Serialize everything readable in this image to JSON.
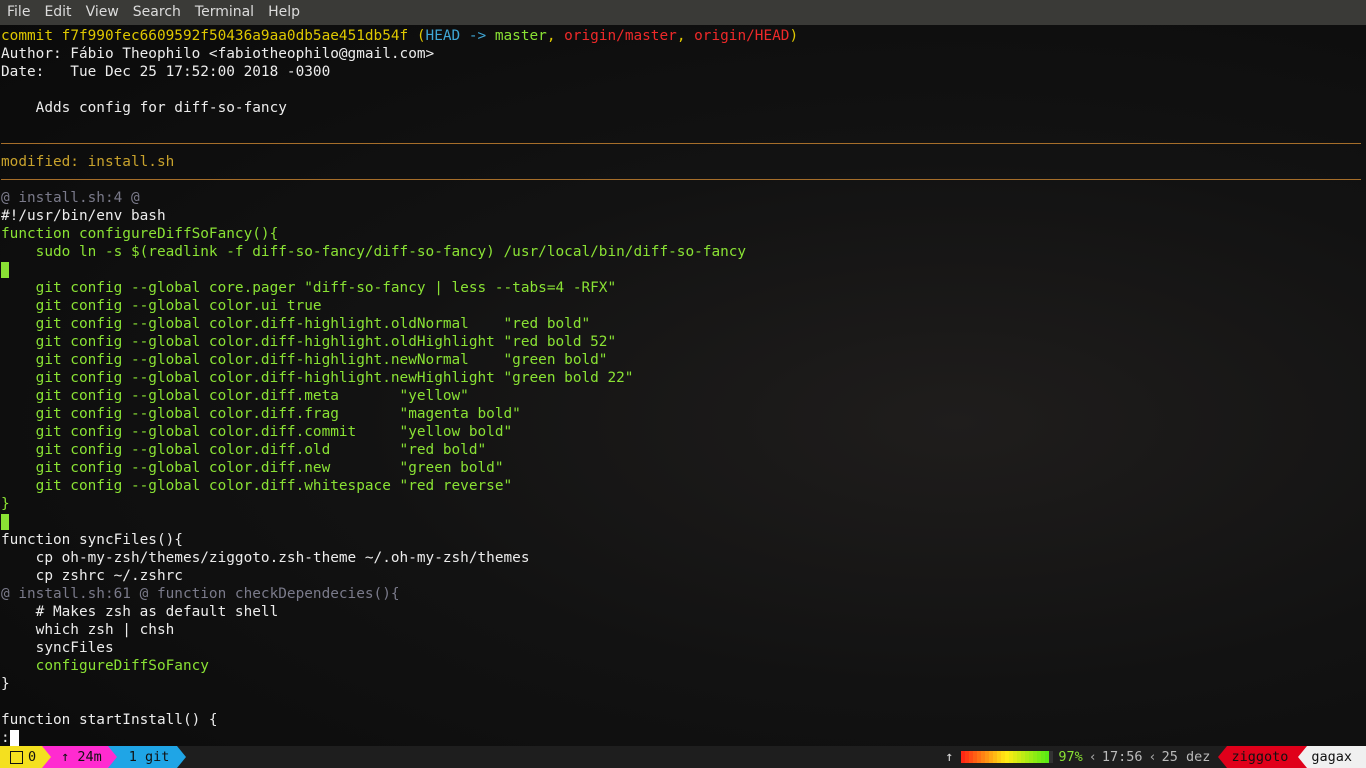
{
  "menu": [
    "File",
    "Edit",
    "View",
    "Search",
    "Terminal",
    "Help"
  ],
  "commit": {
    "prefix": "commit ",
    "hash": "f7f990fec6609592f50436a9aa0db5ae451db54f",
    "open": " (",
    "head": "HEAD",
    "arrow": " -> ",
    "branch": "master",
    "sep1": ", ",
    "origin_master": "origin/master",
    "sep2": ", ",
    "origin_head": "origin/HEAD",
    "close": ")",
    "author": "Author: Fábio Theophilo <fabiotheophilo@gmail.com>",
    "date": "Date:   Tue Dec 25 17:52:00 2018 -0300",
    "message": "    Adds config for diff-so-fancy"
  },
  "modified": "modified: install.sh",
  "hunk1": "@ install.sh:4 @",
  "hunk2_marker": "@ install.sh:61 @ ",
  "hunk2_context": "function checkDependecies(){",
  "code": {
    "shebang": "#!/usr/bin/env bash",
    "fn_head": "function configureDiffSoFancy(){",
    "sudo": "    sudo ln -s $(readlink -f diff-so-fancy/diff-so-fancy) /usr/local/bin/diff-so-fancy",
    "git_lines": [
      "    git config --global core.pager \"diff-so-fancy | less --tabs=4 -RFX\"",
      "    git config --global color.ui true",
      "    git config --global color.diff-highlight.oldNormal    \"red bold\"",
      "    git config --global color.diff-highlight.oldHighlight \"red bold 52\"",
      "    git config --global color.diff-highlight.newNormal    \"green bold\"",
      "    git config --global color.diff-highlight.newHighlight \"green bold 22\"",
      "    git config --global color.diff.meta       \"yellow\"",
      "    git config --global color.diff.frag       \"magenta bold\"",
      "    git config --global color.diff.commit     \"yellow bold\"",
      "    git config --global color.diff.old        \"red bold\"",
      "    git config --global color.diff.new        \"green bold\"",
      "    git config --global color.diff.whitespace \"red reverse\""
    ],
    "close_brace": "}",
    "sync_head": "function syncFiles(){",
    "cp1": "    cp oh-my-zsh/themes/ziggoto.zsh-theme ~/.oh-my-zsh/themes",
    "cp2": "    cp zshrc ~/.zshrc",
    "comment": "    # Makes zsh as default shell",
    "which": "    which zsh | chsh",
    "sync_call": "    syncFiles",
    "configure_call": "    configureDiffSoFancy",
    "close_brace2": "}",
    "start_install": "function startInstall() {",
    "pager_prompt": ":"
  },
  "status": {
    "jobs": "0",
    "elapsed": "↑ 24m",
    "git": "1 git",
    "up_arrow": "↑",
    "battery_pct": "97%",
    "battery_level": 0.97,
    "time": "17:56",
    "date": "25 dez",
    "host": "ziggoto",
    "user": "gagax"
  },
  "colors": {
    "yellow": "#dfc800",
    "green": "#8ae234",
    "red": "#ef2929",
    "cyan": "#3fa7d6",
    "rule": "#a66e2a",
    "jobs_bg": "#f4e01f",
    "time_bg": "#ff2bd0",
    "git_bg": "#1fa5e6",
    "host_bg": "#e0001a",
    "user_bg": "#f0f0f0"
  }
}
